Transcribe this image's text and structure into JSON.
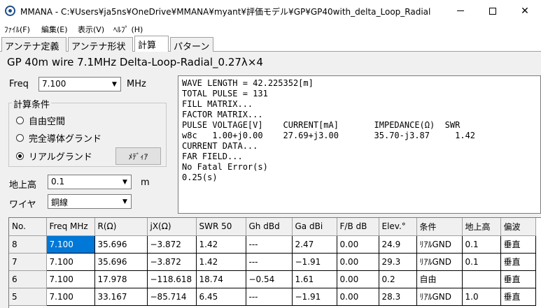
{
  "window": {
    "title": "MMANA - C:¥Users¥ja5ns¥OneDrive¥MMANA¥myant¥評価モデル¥GP¥GP40with_delta_Loop_Radial",
    "min_glyph": "—",
    "close_glyph": "✕"
  },
  "menu": [
    "ﾌｧｲﾙ(F)",
    "編集(E)",
    "表示(V)",
    "ﾍﾙﾌﾟ (H)"
  ],
  "tabs": [
    "アンテナ定義",
    "アンテナ形状",
    "計算",
    "パターン"
  ],
  "active_tab": 2,
  "model_name": "GP 40m wire 7.1MHz Delta-Loop-Radial_0.27λ×4",
  "freq": {
    "label": "Freq",
    "value": "7.100",
    "unit": "MHz"
  },
  "conditions": {
    "title": "計算条件",
    "options": [
      "自由空間",
      "完全導体グランド",
      "リアルグランド"
    ],
    "selected": 2,
    "media_button": "ﾒﾃﾞｨｱ"
  },
  "height": {
    "label": "地上高",
    "value": "0.1",
    "unit": "m"
  },
  "wire": {
    "label": "ワイヤ",
    "value": "銅線"
  },
  "output_lines": [
    "WAVE LENGTH = 42.225352[m]",
    "TOTAL PULSE = 131",
    "FILL MATRIX...",
    "FACTOR MATRIX...",
    "PULSE VOLTAGE[V]    CURRENT[mA]       IMPEDANCE(Ω)  SWR",
    "w8c   1.00+j0.00    27.69+j3.00       35.70-j3.87     1.42",
    "CURRENT DATA...",
    "FAR FIELD...",
    "No Fatal Error(s)",
    "0.25(s)"
  ],
  "table": {
    "headers": [
      "No.",
      "Freq MHz",
      "R(Ω)",
      "jX(Ω)",
      "SWR 50",
      "Gh dBd",
      "Ga dBi",
      "F/B dB",
      "Elev.°",
      "条件",
      "地上高",
      "偏波"
    ],
    "rows": [
      [
        "8",
        "7.100",
        "35.696",
        "−3.872",
        "1.42",
        "---",
        "2.47",
        "0.00",
        "24.9",
        "ﾘｱﾙGND",
        "0.1",
        "垂直"
      ],
      [
        "7",
        "7.100",
        "35.696",
        "−3.872",
        "1.42",
        "---",
        "−1.91",
        "0.00",
        "29.3",
        "ﾘｱﾙGND",
        "0.1",
        "垂直"
      ],
      [
        "6",
        "7.100",
        "17.978",
        "−118.618",
        "18.74",
        "−0.54",
        "1.61",
        "0.00",
        "0.2",
        "自由",
        "",
        "垂直"
      ],
      [
        "5",
        "7.100",
        "33.167",
        "−85.714",
        "6.45",
        "---",
        "−1.91",
        "0.00",
        "28.3",
        "ﾘｱﾙGND",
        "1.0",
        "垂直"
      ]
    ],
    "selected_cell": {
      "row": 0,
      "col": 1
    }
  }
}
